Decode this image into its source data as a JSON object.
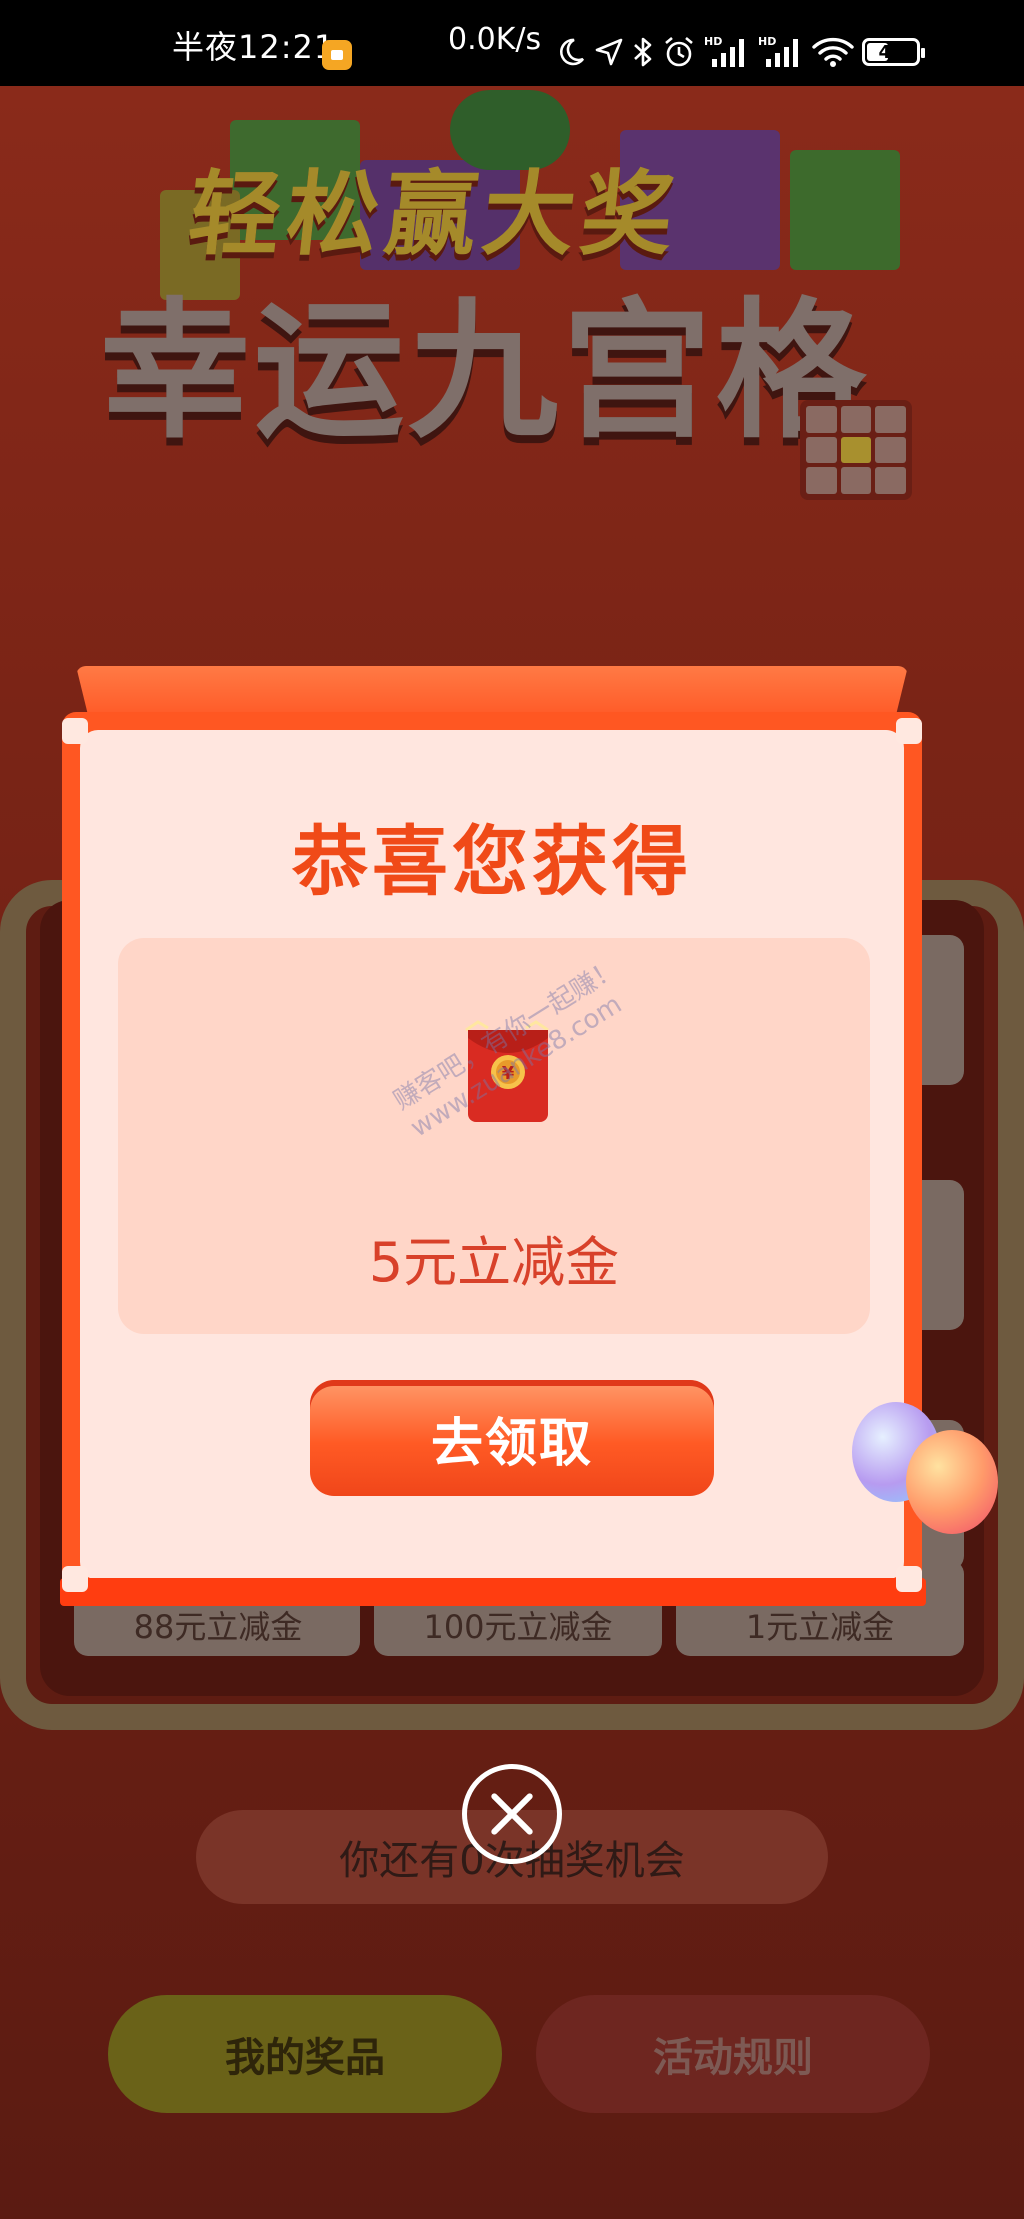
{
  "status_bar": {
    "time": "半夜12:21",
    "network_speed": "0.0K/s",
    "battery_level": "44",
    "icons": [
      "notification-icon",
      "moon-icon",
      "location-icon",
      "bluetooth-icon",
      "alarm-icon",
      "signal-hd-icon",
      "signal-hd-icon",
      "wifi-icon",
      "battery-icon"
    ]
  },
  "background": {
    "title_line1": "轻松赢大奖",
    "title_line2": "幸运九宫格",
    "prizes": [
      "88元立减金",
      "100元立减金",
      "1元立减金"
    ],
    "chances_text": "你还有0次抽奖机会",
    "my_prizes_button": "我的奖品",
    "rules_button": "活动规则"
  },
  "modal": {
    "title": "恭喜您获得",
    "prize_name": "5元立减金",
    "claim_button": "去领取",
    "watermark_line1": "赚客吧，有你一起赚！",
    "watermark_line2": "www.zuanke8.com"
  },
  "colors": {
    "accent": "#ff5722",
    "title": "#f04a18",
    "prize_text": "#d8412a",
    "modal_bg": "#ffe6df"
  }
}
